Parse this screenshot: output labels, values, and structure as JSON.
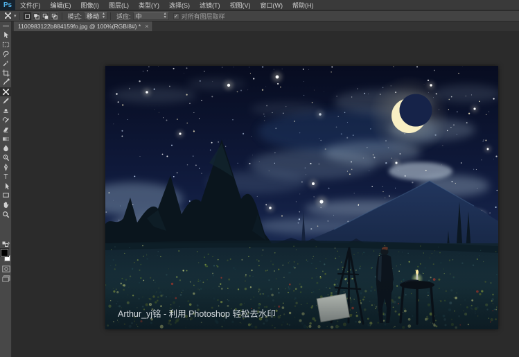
{
  "app": {
    "logo": "Ps"
  },
  "menu_bar": {
    "items": [
      "文件(F)",
      "编辑(E)",
      "图像(I)",
      "图层(L)",
      "类型(Y)",
      "选择(S)",
      "滤镜(T)",
      "视图(V)",
      "窗口(W)",
      "帮助(H)"
    ]
  },
  "options_bar": {
    "tool_icon": "content-aware-move",
    "selection_modes": [
      "new-selection",
      "add-to-selection",
      "subtract-from-selection",
      "intersect-selection"
    ],
    "mode_label": "模式:",
    "mode_value": "移动",
    "adapt_label": "适应:",
    "adapt_value": "中",
    "sample_check": "✓",
    "sample_label": "对所有图层取样"
  },
  "tab": {
    "title": "1100983122b884159fo.jpg @ 100%(RGB/8#) *",
    "close": "×"
  },
  "tools": [
    {
      "name": "move"
    },
    {
      "name": "rectangular-marquee"
    },
    {
      "name": "lasso"
    },
    {
      "name": "quick-selection"
    },
    {
      "name": "crop"
    },
    {
      "name": "eyedropper"
    },
    {
      "name": "content-aware-move",
      "selected": true
    },
    {
      "name": "brush"
    },
    {
      "name": "clone-stamp"
    },
    {
      "name": "history-brush"
    },
    {
      "name": "eraser"
    },
    {
      "name": "gradient"
    },
    {
      "name": "blur"
    },
    {
      "name": "dodge"
    },
    {
      "name": "pen"
    },
    {
      "name": "type"
    },
    {
      "name": "path-selection"
    },
    {
      "name": "rectangle-shape"
    },
    {
      "name": "hand"
    },
    {
      "name": "zoom"
    }
  ],
  "tool_controls": {
    "foreground_color": "#000000",
    "background_color": "#ffffff"
  },
  "canvas": {
    "watermark": "Arthur_yj铭 - 利用 Photoshop 轻松去水印",
    "zoom_level": "100%"
  },
  "colors": {
    "ui_bg": "#3a3a3a",
    "pasteboard": "#2b2b2b",
    "accent_blue": "#4fb0e8",
    "sky_top": "#070c20",
    "sky_bottom": "#22375e",
    "cloud": "#cfe6f2",
    "moon": "#f8efc4",
    "field": "#16303a",
    "tree": "#0a151d"
  }
}
